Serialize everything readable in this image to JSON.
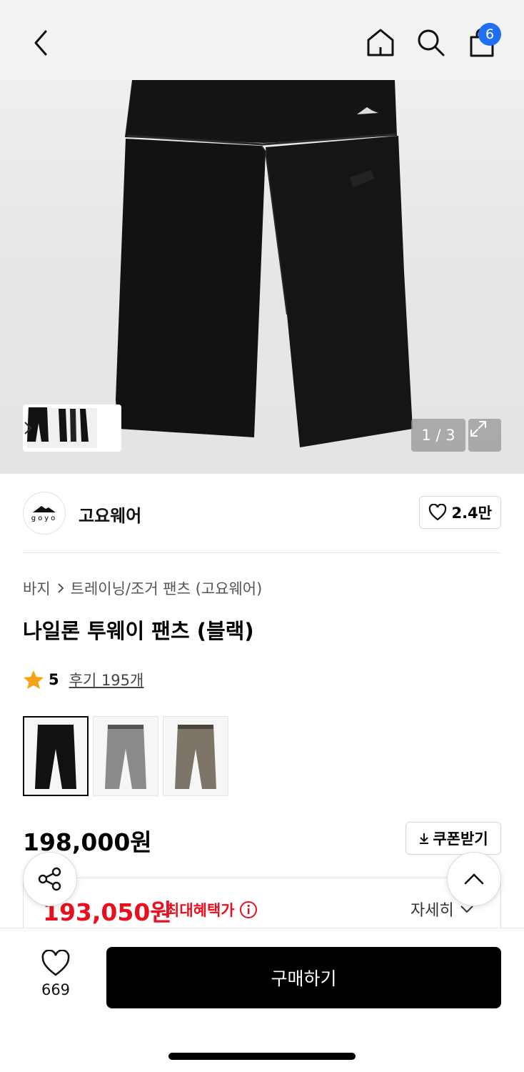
{
  "header": {
    "cart_count": "6"
  },
  "gallery": {
    "counter": "1 / 3"
  },
  "brand": {
    "logo_text": "goyo",
    "name": "고요웨어",
    "likes": "2.4만"
  },
  "product": {
    "breadcrumb": [
      "바지",
      "트레이닝/조거 팬츠 (고요웨어)"
    ],
    "title": "나일론 투웨이 팬츠 (블랙)",
    "rating": "5",
    "reviews": "후기 195개",
    "swatches": [
      {
        "color": "#111111"
      },
      {
        "color": "#8a8b8d"
      },
      {
        "color": "#7c7568"
      }
    ],
    "price": "198,000원",
    "coupon_label": "쿠폰받기",
    "benefit_price": "193,050원",
    "benefit_label": "최대혜택가",
    "detail_label": "자세히"
  },
  "bottom": {
    "wish_count": "669",
    "buy_label": "구매하기"
  },
  "colors": {
    "accent_blue": "#1e6ff1",
    "sale_red": "#e8101e",
    "star": "#f5a316"
  }
}
